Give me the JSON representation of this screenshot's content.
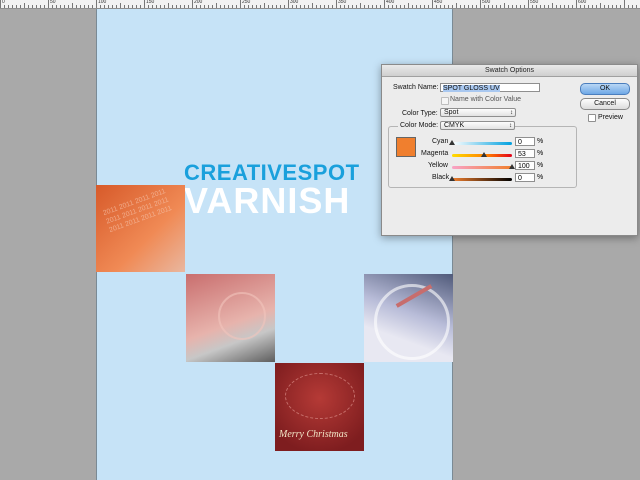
{
  "ruler": {
    "labels": [
      "0",
      "50",
      "100",
      "150",
      "200",
      "250",
      "300",
      "350",
      "400",
      "450",
      "500",
      "550",
      "600"
    ]
  },
  "document": {
    "headline_line1": "CREATIVESPOT",
    "headline_line2": "VARNISH",
    "photo_caption": "Merry Christmas",
    "photo_1_text": "2011 2011 2011 2011 2011 2011 2011 2011 2011 2011 2011 2011"
  },
  "dialog": {
    "title": "Swatch Options",
    "swatch_name_label": "Swatch Name:",
    "swatch_name_value": "SPOT GLOSS UV",
    "name_with_color_value_label": "Name with Color Value",
    "name_with_color_value_checked": false,
    "color_type_label": "Color Type:",
    "color_type_value": "Spot",
    "color_mode_label": "Color Mode:",
    "color_mode_value": "CMYK",
    "ok_label": "OK",
    "cancel_label": "Cancel",
    "preview_label": "Preview",
    "preview_checked": false,
    "swatch_color": "#f07f2e",
    "channels": [
      {
        "name": "Cyan",
        "value": "0"
      },
      {
        "name": "Magenta",
        "value": "53"
      },
      {
        "name": "Yellow",
        "value": "100"
      },
      {
        "name": "Black",
        "value": "0"
      }
    ],
    "percent_symbol": "%"
  }
}
